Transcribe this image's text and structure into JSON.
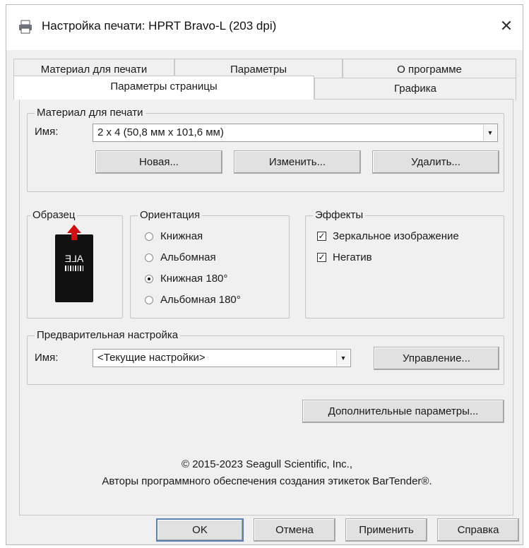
{
  "window": {
    "title": "Настройка печати: HPRT Bravo-L (203 dpi)",
    "close_glyph": "✕"
  },
  "tabs": {
    "back_row": [
      "Материал для печати",
      "Параметры",
      "О программе"
    ],
    "front_row": [
      "Параметры страницы",
      "Графика"
    ]
  },
  "media": {
    "legend": "Материал для печати",
    "name_label": "Имя:",
    "name_value": "2 x 4 (50,8 мм x 101,6 мм)",
    "buttons": {
      "new": "Новая...",
      "edit": "Изменить...",
      "delete": "Удалить..."
    }
  },
  "sample": {
    "legend": "Образец",
    "preview_text": "ALE"
  },
  "orientation": {
    "legend": "Ориентация",
    "options": [
      "Книжная",
      "Альбомная",
      "Книжная 180°",
      "Альбомная 180°"
    ],
    "selected_index": 2
  },
  "effects": {
    "legend": "Эффекты",
    "mirror": {
      "label": "Зеркальное изображение",
      "checked": true
    },
    "negative": {
      "label": "Негатив",
      "checked": true
    }
  },
  "preset": {
    "legend": "Предварительная настройка",
    "name_label": "Имя:",
    "name_value": "<Текущие настройки>",
    "manage_button": "Управление..."
  },
  "advanced_button": "Дополнительные параметры...",
  "copyright": {
    "line1": "© 2015-2023 Seagull Scientific, Inc.,",
    "line2": "Авторы программного обеспечения создания этикеток BarTender®."
  },
  "footer_buttons": {
    "ok": "OK",
    "cancel": "Отмена",
    "apply": "Применить",
    "help": "Справка"
  },
  "colors": {
    "window_bg": "#f0f0f0",
    "default_button_border": "#5a7fb5",
    "preview_bg": "#111111",
    "arrow_red": "#d01010"
  }
}
